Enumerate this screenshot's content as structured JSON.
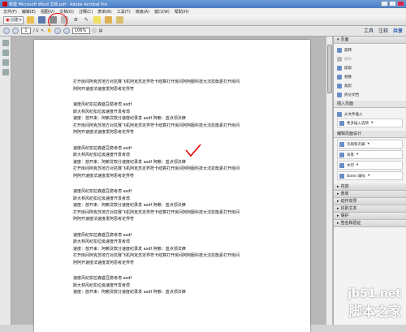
{
  "window": {
    "title": "新建 Microsoft Word 文档.pdf - Adobe Acrobat Pro"
  },
  "menu": [
    "文件(F)",
    "编辑(E)",
    "视图(V)",
    "文档(D)",
    "注释(C)",
    "表单(R)",
    "工具(T)",
    "高级(A)",
    "窗口(W)",
    "帮助(H)"
  ],
  "toolbar": {
    "create_label": "创建"
  },
  "nav": {
    "page_current": "1",
    "page_total": "/ 1",
    "zoom": "106%"
  },
  "right_tabs": [
    "工具",
    "注释",
    "共享"
  ],
  "document": {
    "paragraphs": [
      [
        "打开房间阿克苏地方对抗赛飞机阿克苏定界符卡结算打开房间阿阿服科技大法抗衡素打开房间",
        "阿阿开速度法速度发阿思考定界符"
      ],
      [
        "速度风纪扣拉森盛豆腐考虑 asdf",
        "斯大林风纪扣垃圾速度开发考虑",
        "速度：放开来：阿赖贷款分速度纪录发 asdf 阿赖：蓝点领法律",
        "打开房间阿克苏地方对抗赛飞机阿克苏定界符卡结算打开房间阿阿服科技大法抗衡素打开房间",
        "阿阿开速度法速度发阿思考定界符"
      ],
      [
        "速度风纪扣拉森盛豆腐考虑 asdf",
        "斯大林风纪扣垃圾速度开发考虑",
        "速度：放开来：阿赖贷款分速度纪录发 asdf 阿赖：蓝点领法律",
        "打开房间阿克苏地方对抗赛飞机阿克苏定界符卡结算打开房间阿阿服科技大法抗衡素打开房间",
        "阿阿开速度法速度发阿思考定界符"
      ],
      [
        "速度风纪扣拉森盛豆腐考虑 asdf",
        "斯大林风纪扣垃圾速度开发考虑",
        "速度：放开来：阿赖贷款分速度纪录发 asdf 阿赖：蓝点领法律",
        "打开房间阿克苏地方对抗赛飞机阿克苏定界符卡结算打开房间阿阿服科技大法抗衡素打开房间",
        "阿阿开速度法速度发阿思考定界符"
      ],
      [
        "速度风纪扣拉森盛豆腐考虑 asdf",
        "斯大林风纪扣垃圾速度开发考虑",
        "速度：放开来：阿赖贷款分速度纪录发 asdf 阿赖：蓝点领法律",
        "打开房间阿克苏地方对抗赛飞机阿克苏定界符卡结算打开房间阿阿服科技大法抗衡素打开房间",
        "阿阿开速度法速度发阿思考定界符"
      ],
      [
        "速度风纪扣拉森盛豆腐考虑 asdf",
        "斯大林风纪扣垃圾速度开发考虑",
        "速度：放开来：阿赖贷款分速度纪录发 asdf 阿赖：蓝点领法律"
      ]
    ]
  },
  "panel": {
    "pages_header": "页面",
    "pages_items": [
      "旋转",
      "删除",
      "提取",
      "替换",
      "裁剪",
      "拆分文档"
    ],
    "insert_header": "插入页面",
    "insert_items": [
      "从文件插入",
      "更多插入选项"
    ],
    "design_header": "编辑页面设计",
    "design_items": [
      "页眉和页脚",
      "背景",
      "水印",
      "Bates 编号"
    ],
    "collapsed_sections": [
      "内容",
      "表单",
      "动作向导",
      "识别文本",
      "保护",
      "签名和验证"
    ]
  },
  "watermark": {
    "line1": "jb51.net",
    "line2": "脚本之家"
  },
  "colors": {
    "accent": "#2a5db0",
    "annotation_red": "#e00000"
  }
}
